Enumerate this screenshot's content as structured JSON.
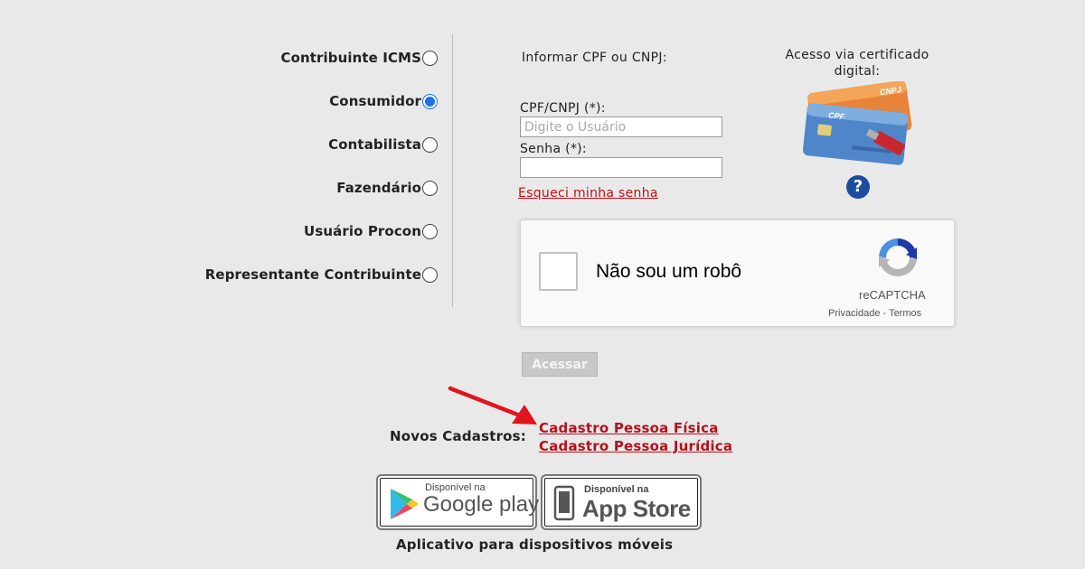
{
  "profiles": [
    {
      "label": "Contribuinte ICMS",
      "checked": false
    },
    {
      "label": "Consumidor",
      "checked": true
    },
    {
      "label": "Contabilista",
      "checked": false
    },
    {
      "label": "Fazendário",
      "checked": false
    },
    {
      "label": "Usuário Procon",
      "checked": false
    },
    {
      "label": "Representante Contribuinte",
      "checked": false
    }
  ],
  "login": {
    "intro": "Informar CPF ou CNPJ:",
    "user_label": "CPF/CNPJ (*):",
    "user_placeholder": "Digite o Usuário",
    "user_value": "",
    "password_label": "Senha (*):",
    "password_value": "",
    "forgot_link": "Esqueci minha senha",
    "submit_label": "Acessar"
  },
  "certificate": {
    "title_line1": "Acesso via certificado",
    "title_line2": "digital:",
    "card_front": "CPF",
    "card_back": "CNPJ",
    "help_icon": "question-circle-icon",
    "help_glyph": "?"
  },
  "recaptcha": {
    "label": "Não sou um robô",
    "brand": "reCAPTCHA",
    "privacy": "Privacidade",
    "separator": " - ",
    "terms": "Termos"
  },
  "register": {
    "label": "Novos Cadastros:",
    "links": [
      "Cadastro Pessoa Física",
      "Cadastro Pessoa Jurídica"
    ]
  },
  "apps": {
    "google_small": "Disponível na",
    "google_big": "Google play",
    "apple_small": "Disponível na",
    "apple_big": "App Store",
    "caption": "Aplicativo para dispositivos móveis"
  },
  "colors": {
    "background": "#e9e9e9",
    "link_red": "#c0101a",
    "arrow_red": "#e0151f",
    "radio_selected": "#1a73e8",
    "help_icon_blue": "#1d4e9e"
  }
}
